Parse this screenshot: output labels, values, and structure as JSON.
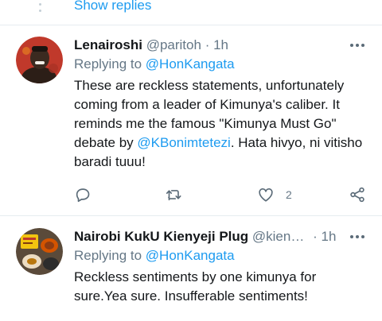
{
  "thread": {
    "show_replies_label": "Show replies"
  },
  "tweets": [
    {
      "display_name": "Lenairoshi",
      "handle": "@paritoh",
      "separator": "·",
      "time": "1h",
      "replying_prefix": "Replying to",
      "replying_to": "@HonKangata",
      "text_part1": "These are reckless statements, unfortunately coming from a leader of Kimunya's caliber. It reminds me the famous \"Kimunya Must Go\" debate by ",
      "text_mention": "@KBonimtetezi",
      "text_part2": ". Hata hivyo, ni vitisho baradi tuuu!",
      "like_count": "2",
      "avatar_colors": {
        "bg": "#c0392b",
        "face": "#3b2a20"
      }
    },
    {
      "display_name": "Nairobi KukU Kienyeji Plug",
      "handle": "@kien…",
      "separator": "·",
      "time": "1h",
      "replying_prefix": "Replying to",
      "replying_to": "@HonKangata",
      "text": "Reckless sentiments by one kimunya for sure.Yea sure. Insufferable sentiments!",
      "avatar_colors": {
        "bg": "#5a4a3a",
        "plate": "#f1c40f"
      }
    }
  ],
  "icons": {
    "reply": "reply-icon",
    "retweet": "retweet-icon",
    "like": "heart-icon",
    "share": "share-icon",
    "more": "more-icon"
  },
  "colors": {
    "link": "#1d9bf0",
    "muted": "#657786",
    "text": "#14171a",
    "icon": "#5b6b78"
  }
}
